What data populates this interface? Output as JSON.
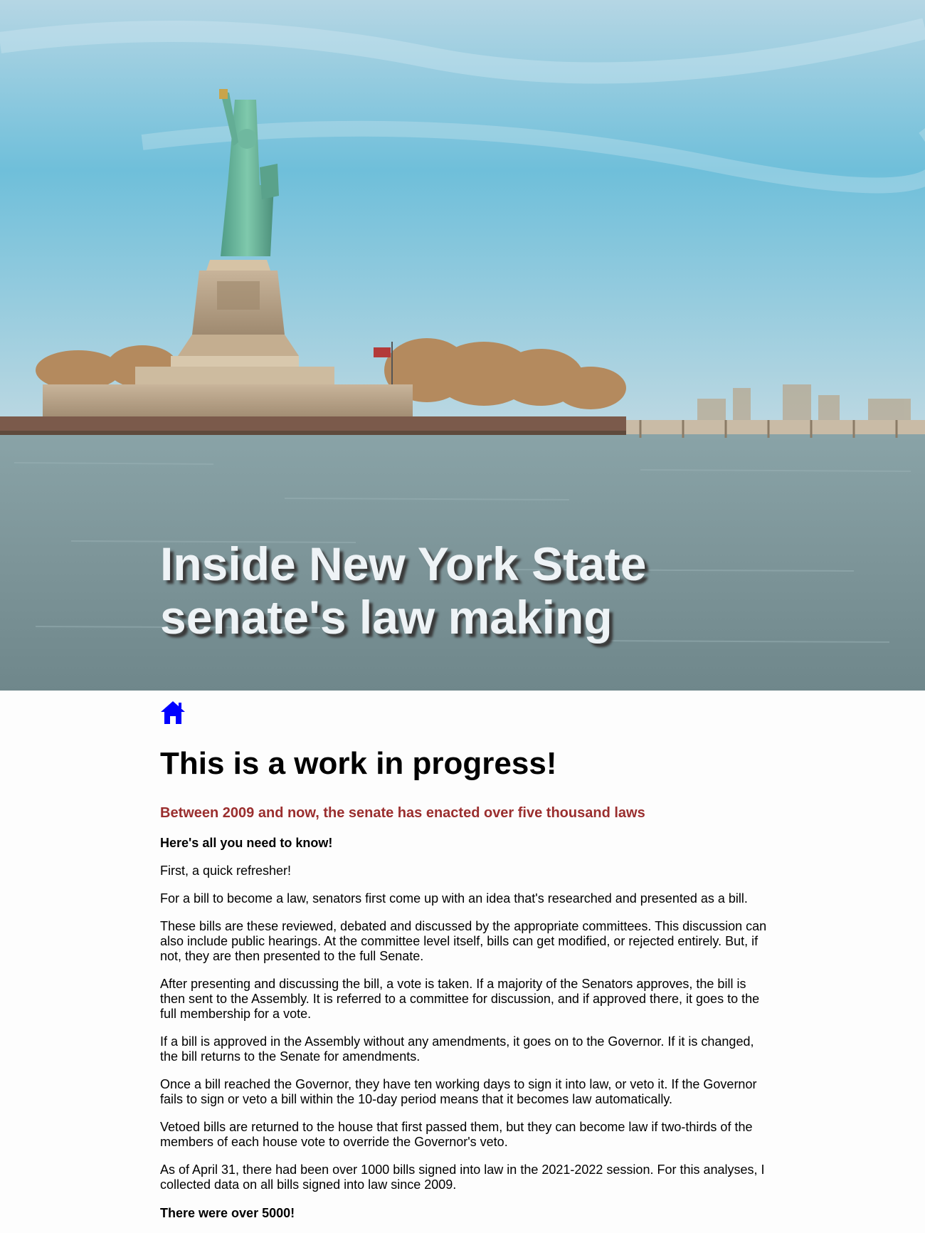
{
  "hero": {
    "title_line1": "Inside New York State",
    "title_line2": "senate's law making"
  },
  "nav": {
    "home_icon": "home-icon",
    "home_color": "#0000ff"
  },
  "main": {
    "heading": "This is a work in progress!",
    "lede": "Between 2009 and now, the senate has enacted over five thousand laws",
    "lede_color": "#9a2e2e",
    "callout": "Here's all you need to know!",
    "paragraphs": [
      "First, a quick refresher!",
      "For a bill to become a law, senators first come up with an idea that's researched and presented as a bill.",
      "These bills are these reviewed, debated and discussed by the appropriate committees. This discussion can also include public hearings. At the committee level itself, bills can get modified, or rejected entirely. But, if not, they are then presented to the full Senate.",
      "After presenting and discussing the bill, a vote is taken. If a majority of the Senators approves, the bill is then sent to the Assembly. It is referred to a committee for discussion, and if approved there, it goes to the full membership for a vote.",
      "If a bill is approved in the Assembly without any amendments, it goes on to the Governor. If it is changed, the bill returns to the Senate for amendments.",
      "Once a bill reached the Governor, they have ten working days to sign it into law, or veto it. If the Governor fails to sign or veto a bill within the 10-day period means that it becomes law automatically.",
      "Vetoed bills are returned to the house that first passed them, but they can become law if two-thirds of the members of each house vote to override the Governor's veto.",
      "As of April 31, there had been over 1000 bills signed into law in the 2021-2022 session. For this analyses, I collected data on all bills signed into law since 2009."
    ],
    "closing": "There were over 5000!"
  }
}
